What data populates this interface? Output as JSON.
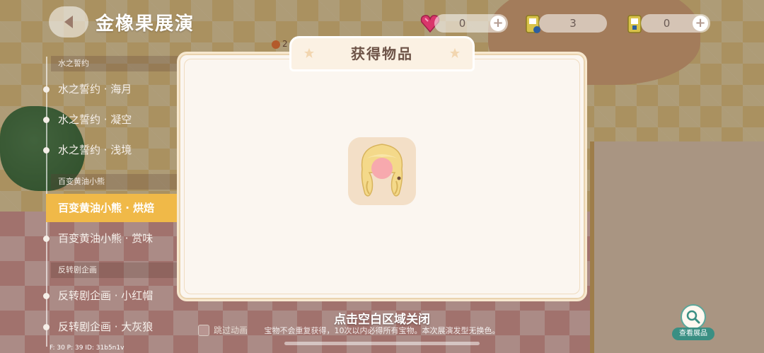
{
  "header": {
    "title": "金橡果展演",
    "timer_text": "2"
  },
  "resources": {
    "gems": "0",
    "tickets_a": "3",
    "tickets_b": "0"
  },
  "sidebar": {
    "sections": [
      {
        "title": "水之誓约",
        "items": [
          "水之誓约 · 海月",
          "水之誓约 · 凝空",
          "水之誓约 · 浅境"
        ]
      },
      {
        "title": "百变黄油小熊",
        "items": [
          "百变黄油小熊 · 烘焙",
          "百变黄油小熊 · 赏味"
        ]
      },
      {
        "title": "反转剧企画",
        "items": [
          "反转剧企画 · 小红帽",
          "反转剧企画 · 大灰狼"
        ]
      }
    ],
    "active_item": "百变黄油小熊 · 烘焙"
  },
  "modal": {
    "title": "获得物品",
    "item_icon": "blonde-hairstyle-item-icon",
    "close_hint": "点击空白区域关闭",
    "sub_hint": "宝物不会重复获得，10次以内必得所有宝物。本次展演发型无换色。"
  },
  "controls": {
    "skip_animation": "跳过动画",
    "view_exhibits": "查看展品"
  },
  "debug": "F: 30    P: 39    ID: 31b5n1v",
  "colors": {
    "accent": "#f0b948",
    "modal_bg": "#fbf6f0",
    "title_text": "#6d5347",
    "view_button": "#3a8f83"
  }
}
